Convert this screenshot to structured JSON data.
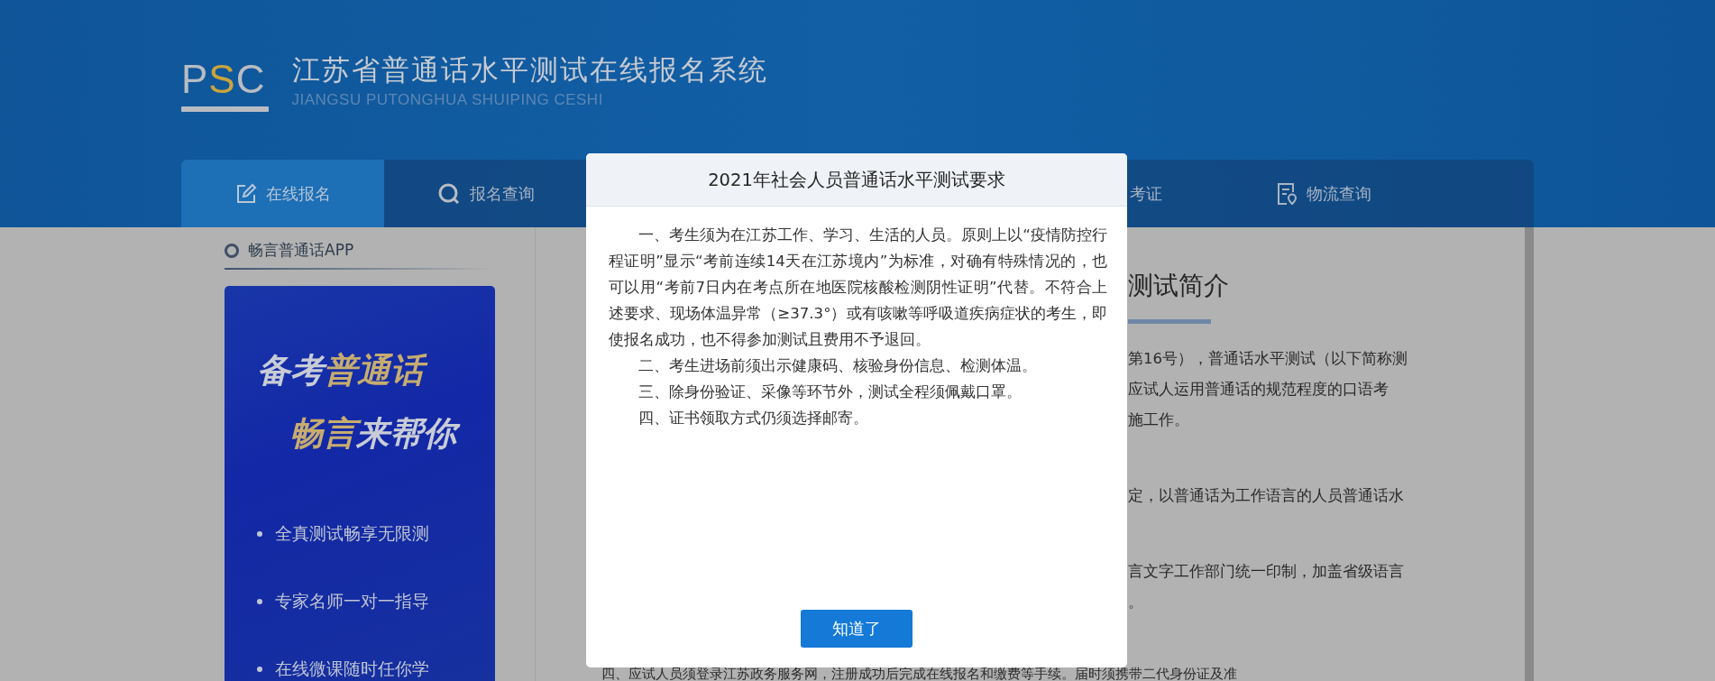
{
  "header": {
    "logo": {
      "letters": [
        {
          "text": "P",
          "accent": false
        },
        {
          "text": "S",
          "accent": true
        },
        {
          "text": "C",
          "accent": false
        }
      ]
    },
    "title": "江苏省普通话水平测试在线报名系统",
    "subtitle": "JIANGSU PUTONGHUA SHUIPING CESHI"
  },
  "nav": {
    "items": [
      {
        "label": "在线报名",
        "selected": true
      },
      {
        "label": "报名查询",
        "selected": false
      },
      {
        "label": "考证",
        "selected": false
      },
      {
        "label": "物流查询",
        "selected": false
      }
    ]
  },
  "sidebar": {
    "heading": "畅言普通话APP",
    "banner": {
      "headline": [
        [
          {
            "text": "备考",
            "highlight": false
          },
          {
            "text": "普通话",
            "highlight": true
          }
        ],
        [
          {
            "text": "畅言",
            "highlight": true
          },
          {
            "text": "来帮你",
            "highlight": false
          }
        ]
      ],
      "features": [
        "全真测试畅享无限测",
        "专家名师一对一指导",
        "在线微课随时任你学"
      ]
    }
  },
  "content": {
    "heading": "测试简介",
    "fragments": [
      [
        "第16号），普通话水平测试（以下简称测",
        "应试人运用普通话的规范程度的口语考",
        "施工作。"
      ],
      [
        "定，以普通话为工作语言的人员普通话水"
      ],
      [
        "言文字工作部门统一印制，加盖省级语言",
        "。"
      ]
    ],
    "bottom_line": "四、应试人员须登录江苏政务服务网，注册成功后完成在线报名和缴费等手续。届时须携带二代身份证及准"
  },
  "dialog": {
    "title": "2021年社会人员普通话水平测试要求",
    "paragraphs": [
      "一、考生须为在江苏工作、学习、生活的人员。原则上以“疫情防控行程证明”显示“考前连续14天在江苏境内”为标准，对确有特殊情况的，也可以用“考前7日内在考点所在地医院核酸检测阴性证明”代替。不符合上述要求、现场体温异常（≥37.3°）或有咳嗽等呼吸道疾病症状的考生，即使报名成功，也不得参加测试且费用不予退回。",
      "二、考生进场前须出示健康码、核验身份信息、检测体温。",
      "三、除身份验证、采像等环节外，测试全程须佩戴口罩。",
      "四、证书领取方式仍须选择邮寄。"
    ],
    "button": "知道了"
  }
}
